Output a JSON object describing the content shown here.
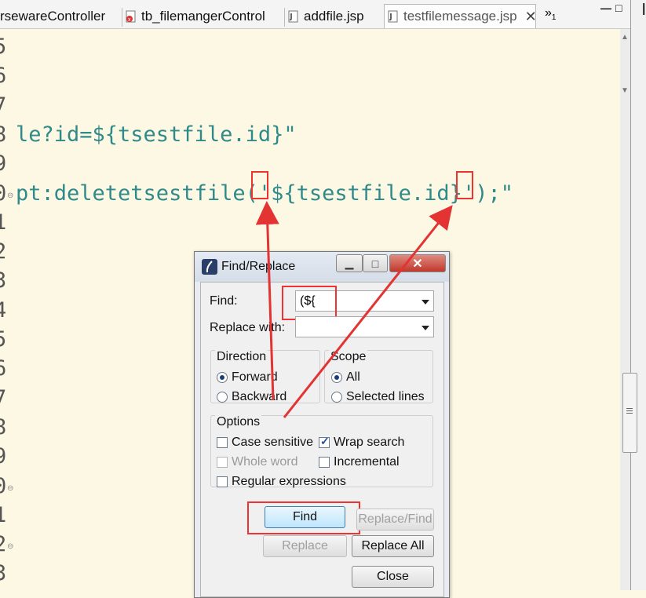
{
  "tabs": [
    {
      "label": "rsewareController",
      "active": false
    },
    {
      "label": "tb_filemangerControl",
      "active": false
    },
    {
      "label": "addfile.jsp",
      "active": false
    },
    {
      "label": "testfilemessage.jsp",
      "active": true
    }
  ],
  "tab_close": "✕",
  "tab_overflow": "»",
  "tab_overflow_count": "1",
  "window_controls": {
    "minimize": "—",
    "maximize": "□"
  },
  "right_strip_glyph": "l",
  "editor": {
    "line_numbers": [
      "5",
      "6",
      "7",
      "8",
      "9",
      "0",
      "1",
      "2",
      "3",
      "4",
      "5",
      "6",
      "7",
      "8",
      "9",
      "0",
      "1",
      "2",
      "3"
    ],
    "lines": [
      {
        "index": 3,
        "text": "le?id=${tsestfile.id}\""
      },
      {
        "index": 5,
        "text": "pt:deletetsestfile('${tsestfile.id}');\""
      }
    ]
  },
  "dialog": {
    "title": "Find/Replace",
    "find_label": "Find:",
    "find_value": "(${",
    "replace_label": "Replace with:",
    "replace_value": "",
    "direction": {
      "title": "Direction",
      "forward": "Forward",
      "backward": "Backward",
      "selected": "forward"
    },
    "scope": {
      "title": "Scope",
      "all": "All",
      "selected_lines": "Selected lines",
      "selected": "all"
    },
    "options": {
      "title": "Options",
      "case_sensitive": "Case sensitive",
      "wrap_search": "Wrap search",
      "whole_word": "Whole word",
      "incremental": "Incremental",
      "regular_expressions": "Regular expressions",
      "checked": {
        "case_sensitive": false,
        "wrap_search": true,
        "whole_word": false,
        "incremental": false,
        "regular_expressions": false
      }
    },
    "buttons": {
      "find": "Find",
      "replace_find": "Replace/Find",
      "replace": "Replace",
      "replace_all": "Replace All",
      "close": "Close"
    },
    "window_buttons": {
      "minimize": "▁",
      "maximize": "□",
      "close": "✕"
    }
  },
  "colors": {
    "editor_bg": "#fdf8e4",
    "code_teal": "#2f8a8a",
    "annotation_red": "#e33333"
  }
}
